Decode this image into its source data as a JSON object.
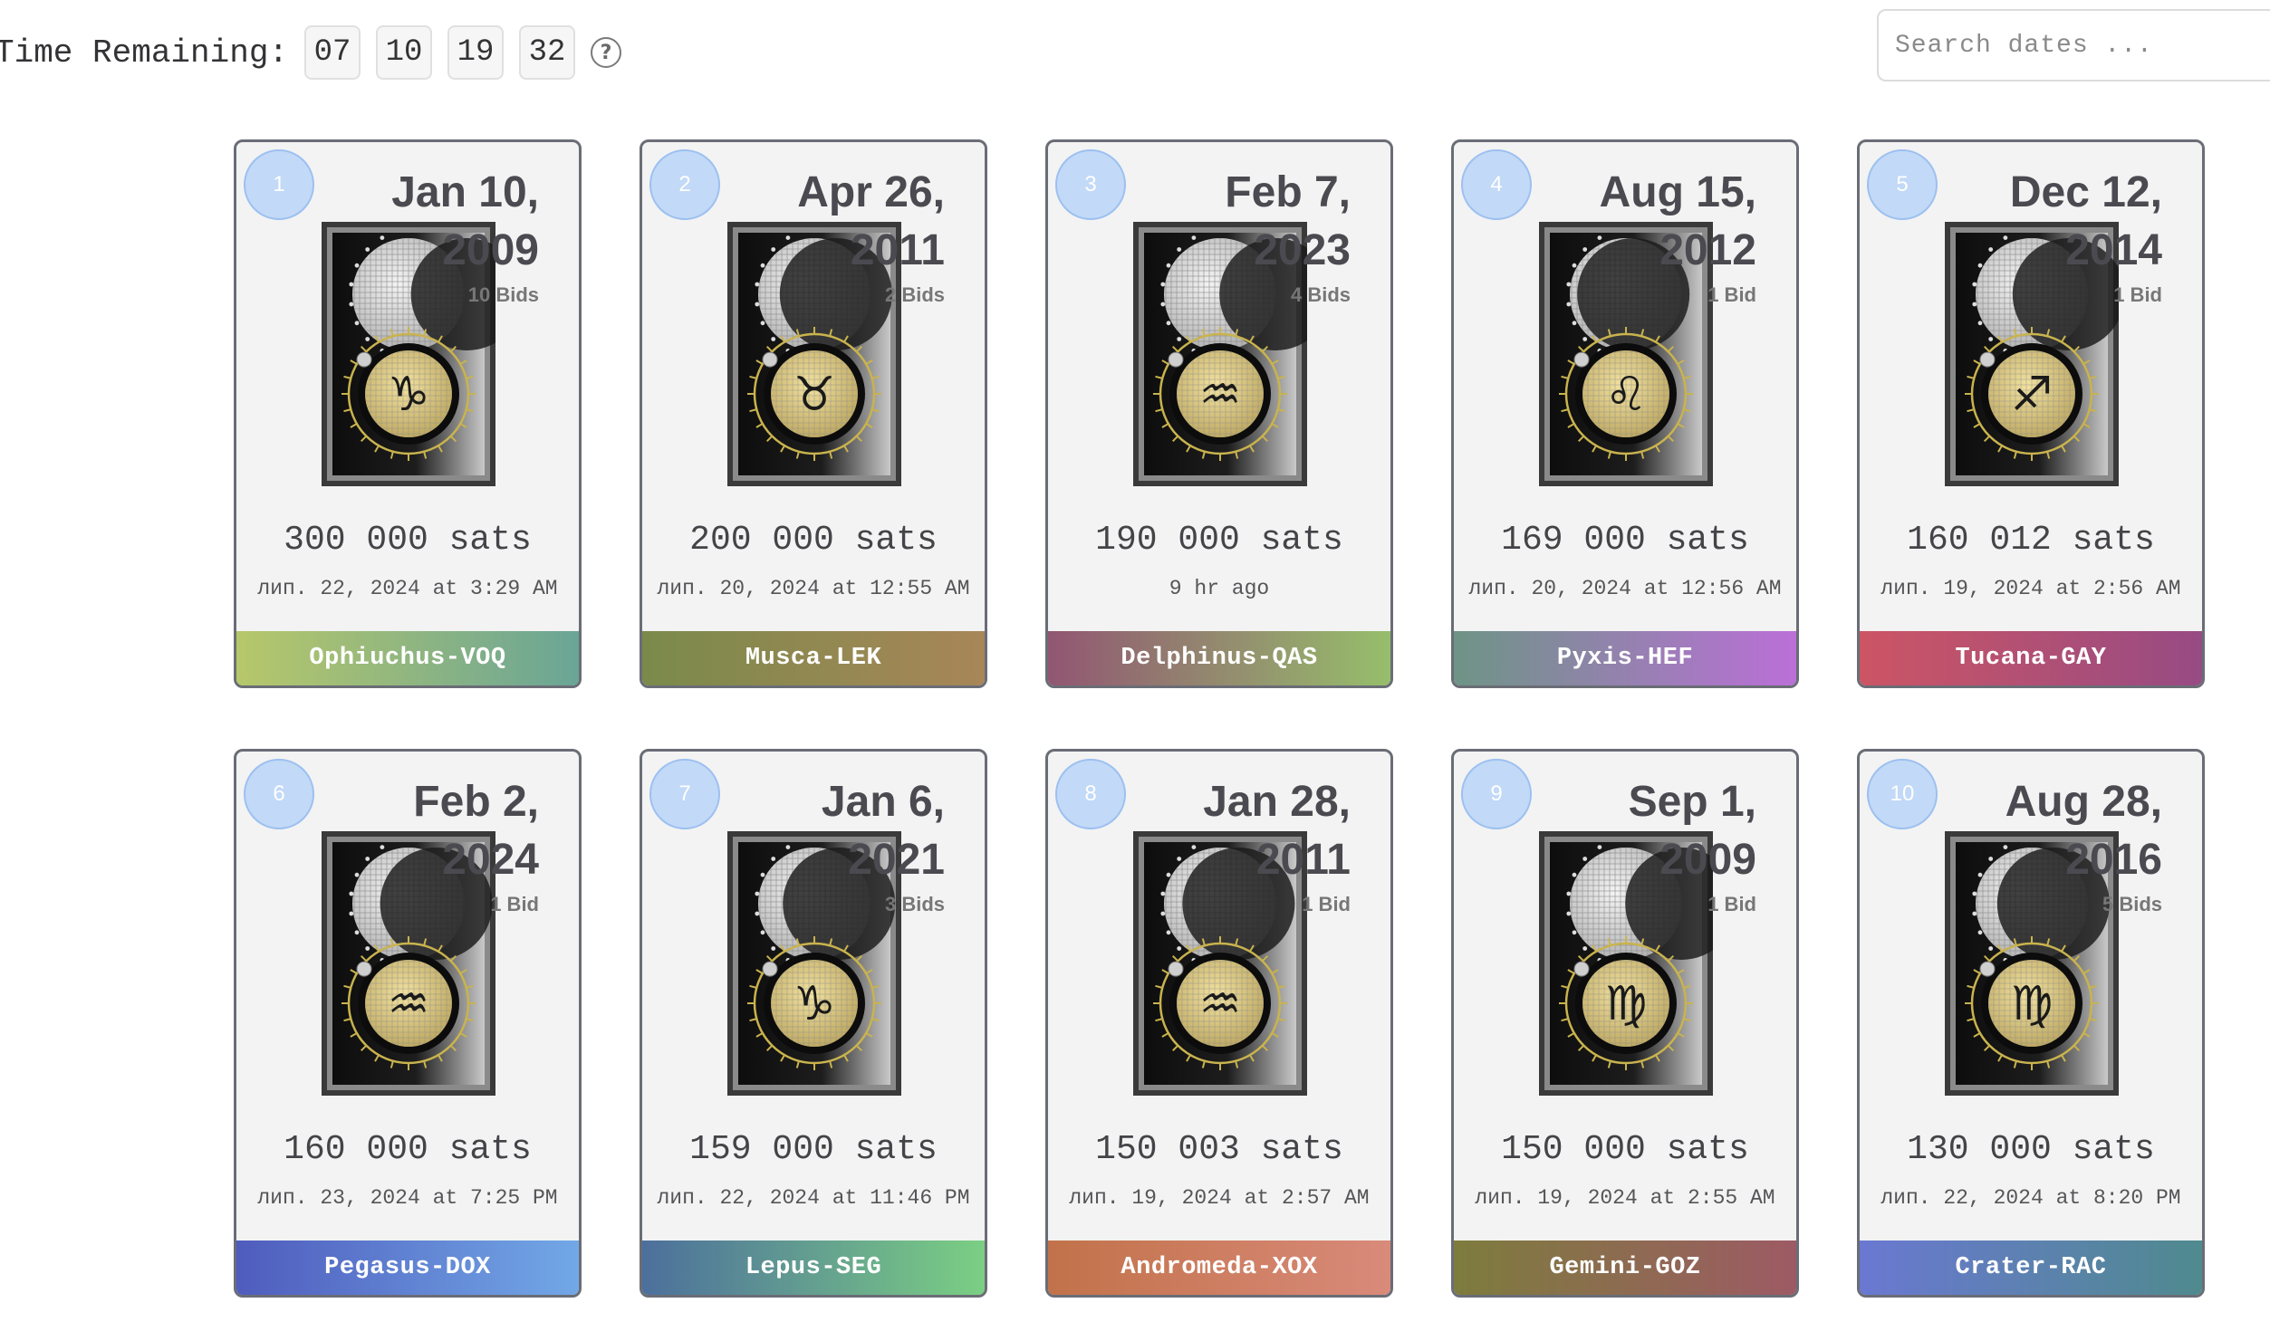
{
  "timer": {
    "label": "Time Remaining:",
    "days": "07",
    "hours": "10",
    "minutes": "19",
    "seconds": "32",
    "help_glyph": "?"
  },
  "search": {
    "placeholder": "Search dates ..."
  },
  "cards": [
    {
      "rank": "1",
      "date_line1": "Jan 10,",
      "date_line2": "2009",
      "bids": "10 Bids",
      "price": "300 000 sats",
      "time": "лип. 22, 2024 at 3:29 AM",
      "name": "Ophiuchus-VOQ",
      "gradient": [
        "#b7c76a",
        "#6aa596"
      ],
      "moon": 0.95,
      "symbol": "♑"
    },
    {
      "rank": "2",
      "date_line1": "Apr 26,",
      "date_line2": "2011",
      "bids": "2 Bids",
      "price": "200 000 sats",
      "time": "лип. 20, 2024 at 12:55 AM",
      "name": "Musca-LEK",
      "gradient": [
        "#7a8a4a",
        "#a88658"
      ],
      "moon": 0.35,
      "symbol": "♉"
    },
    {
      "rank": "3",
      "date_line1": "Feb 7,",
      "date_line2": "2023",
      "bids": "4 Bids",
      "price": "190 000 sats",
      "time": "9 hr ago",
      "name": "Delphinus-QAS",
      "gradient": [
        "#915672",
        "#96be6b"
      ],
      "moon": 0.9,
      "symbol": "♒"
    },
    {
      "rank": "4",
      "date_line1": "Aug 15,",
      "date_line2": "2012",
      "bids": "1 Bid",
      "price": "169 000 sats",
      "time": "лип. 20, 2024 at 12:56 AM",
      "name": "Pyxis-HEF",
      "gradient": [
        "#6e9486",
        "#bb6fd8"
      ],
      "moon": 0.12,
      "symbol": "♌"
    },
    {
      "rank": "5",
      "date_line1": "Dec 12,",
      "date_line2": "2014",
      "bids": "1 Bid",
      "price": "160 012 sats",
      "time": "лип. 19, 2024 at 2:56 AM",
      "name": "Tucana-GAY",
      "gradient": [
        "#cc5564",
        "#974b84"
      ],
      "moon": 0.6,
      "symbol": "♐"
    },
    {
      "rank": "6",
      "date_line1": "Feb 2,",
      "date_line2": "2024",
      "bids": "1 Bid",
      "price": "160 000 sats",
      "time": "лип. 23, 2024 at 7:25 PM",
      "name": "Pegasus-DOX",
      "gradient": [
        "#4f5cbd",
        "#72a8e7"
      ],
      "moon": 0.45,
      "symbol": "♒"
    },
    {
      "rank": "7",
      "date_line1": "Jan 6,",
      "date_line2": "2021",
      "bids": "3 Bids",
      "price": "159 000 sats",
      "time": "лип. 22, 2024 at 11:46 PM",
      "name": "Lepus-SEG",
      "gradient": [
        "#4c6f9c",
        "#7bcf83"
      ],
      "moon": 0.4,
      "symbol": "♑"
    },
    {
      "rank": "8",
      "date_line1": "Jan 28,",
      "date_line2": "2011",
      "bids": "1 Bid",
      "price": "150 003 sats",
      "time": "лип. 19, 2024 at 2:57 AM",
      "name": "Andromeda-XOX",
      "gradient": [
        "#c27249",
        "#d98a7a"
      ],
      "moon": 0.3,
      "symbol": "♒"
    },
    {
      "rank": "9",
      "date_line1": "Sep 1,",
      "date_line2": "2009",
      "bids": "1 Bid",
      "price": "150 000 sats",
      "time": "лип. 19, 2024 at 2:55 AM",
      "name": "Gemini-GOZ",
      "gradient": [
        "#7d7c3d",
        "#9d5a64"
      ],
      "moon": 0.9,
      "symbol": "♍"
    },
    {
      "rank": "10",
      "date_line1": "Aug 28,",
      "date_line2": "2016",
      "bids": "5 Bids",
      "price": "130 000 sats",
      "time": "лип. 22, 2024 at 8:20 PM",
      "name": "Crater-RAC",
      "gradient": [
        "#6a78d2",
        "#4f8a8e"
      ],
      "moon": 0.35,
      "symbol": "♍"
    }
  ]
}
